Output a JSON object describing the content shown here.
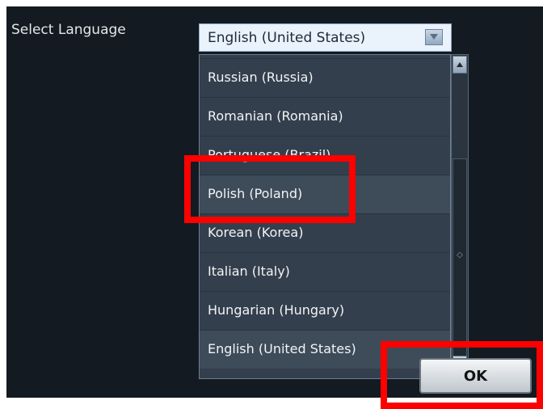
{
  "dialog": {
    "label": "Select Language",
    "selected_value": "English (United States)"
  },
  "language_list": {
    "items": [
      {
        "label": "Russian (Russia)"
      },
      {
        "label": "Romanian (Romania)"
      },
      {
        "label": "Portuguese (Brazil)"
      },
      {
        "label": "Polish (Poland)",
        "hovered": true
      },
      {
        "label": "Korean (Korea)"
      },
      {
        "label": "Italian (Italy)"
      },
      {
        "label": "Hungarian (Hungary)"
      },
      {
        "label": "English (United States)",
        "hovered": true
      }
    ]
  },
  "buttons": {
    "ok_label": "OK"
  },
  "icons": {
    "dropdown": "chevron-down-icon",
    "scroll_up": "arrow-up-icon",
    "scroll_down": "arrow-down-icon"
  },
  "colors": {
    "panel_background": "#141a21",
    "list_background": "#333f4c",
    "highlight": "#ff0000"
  }
}
